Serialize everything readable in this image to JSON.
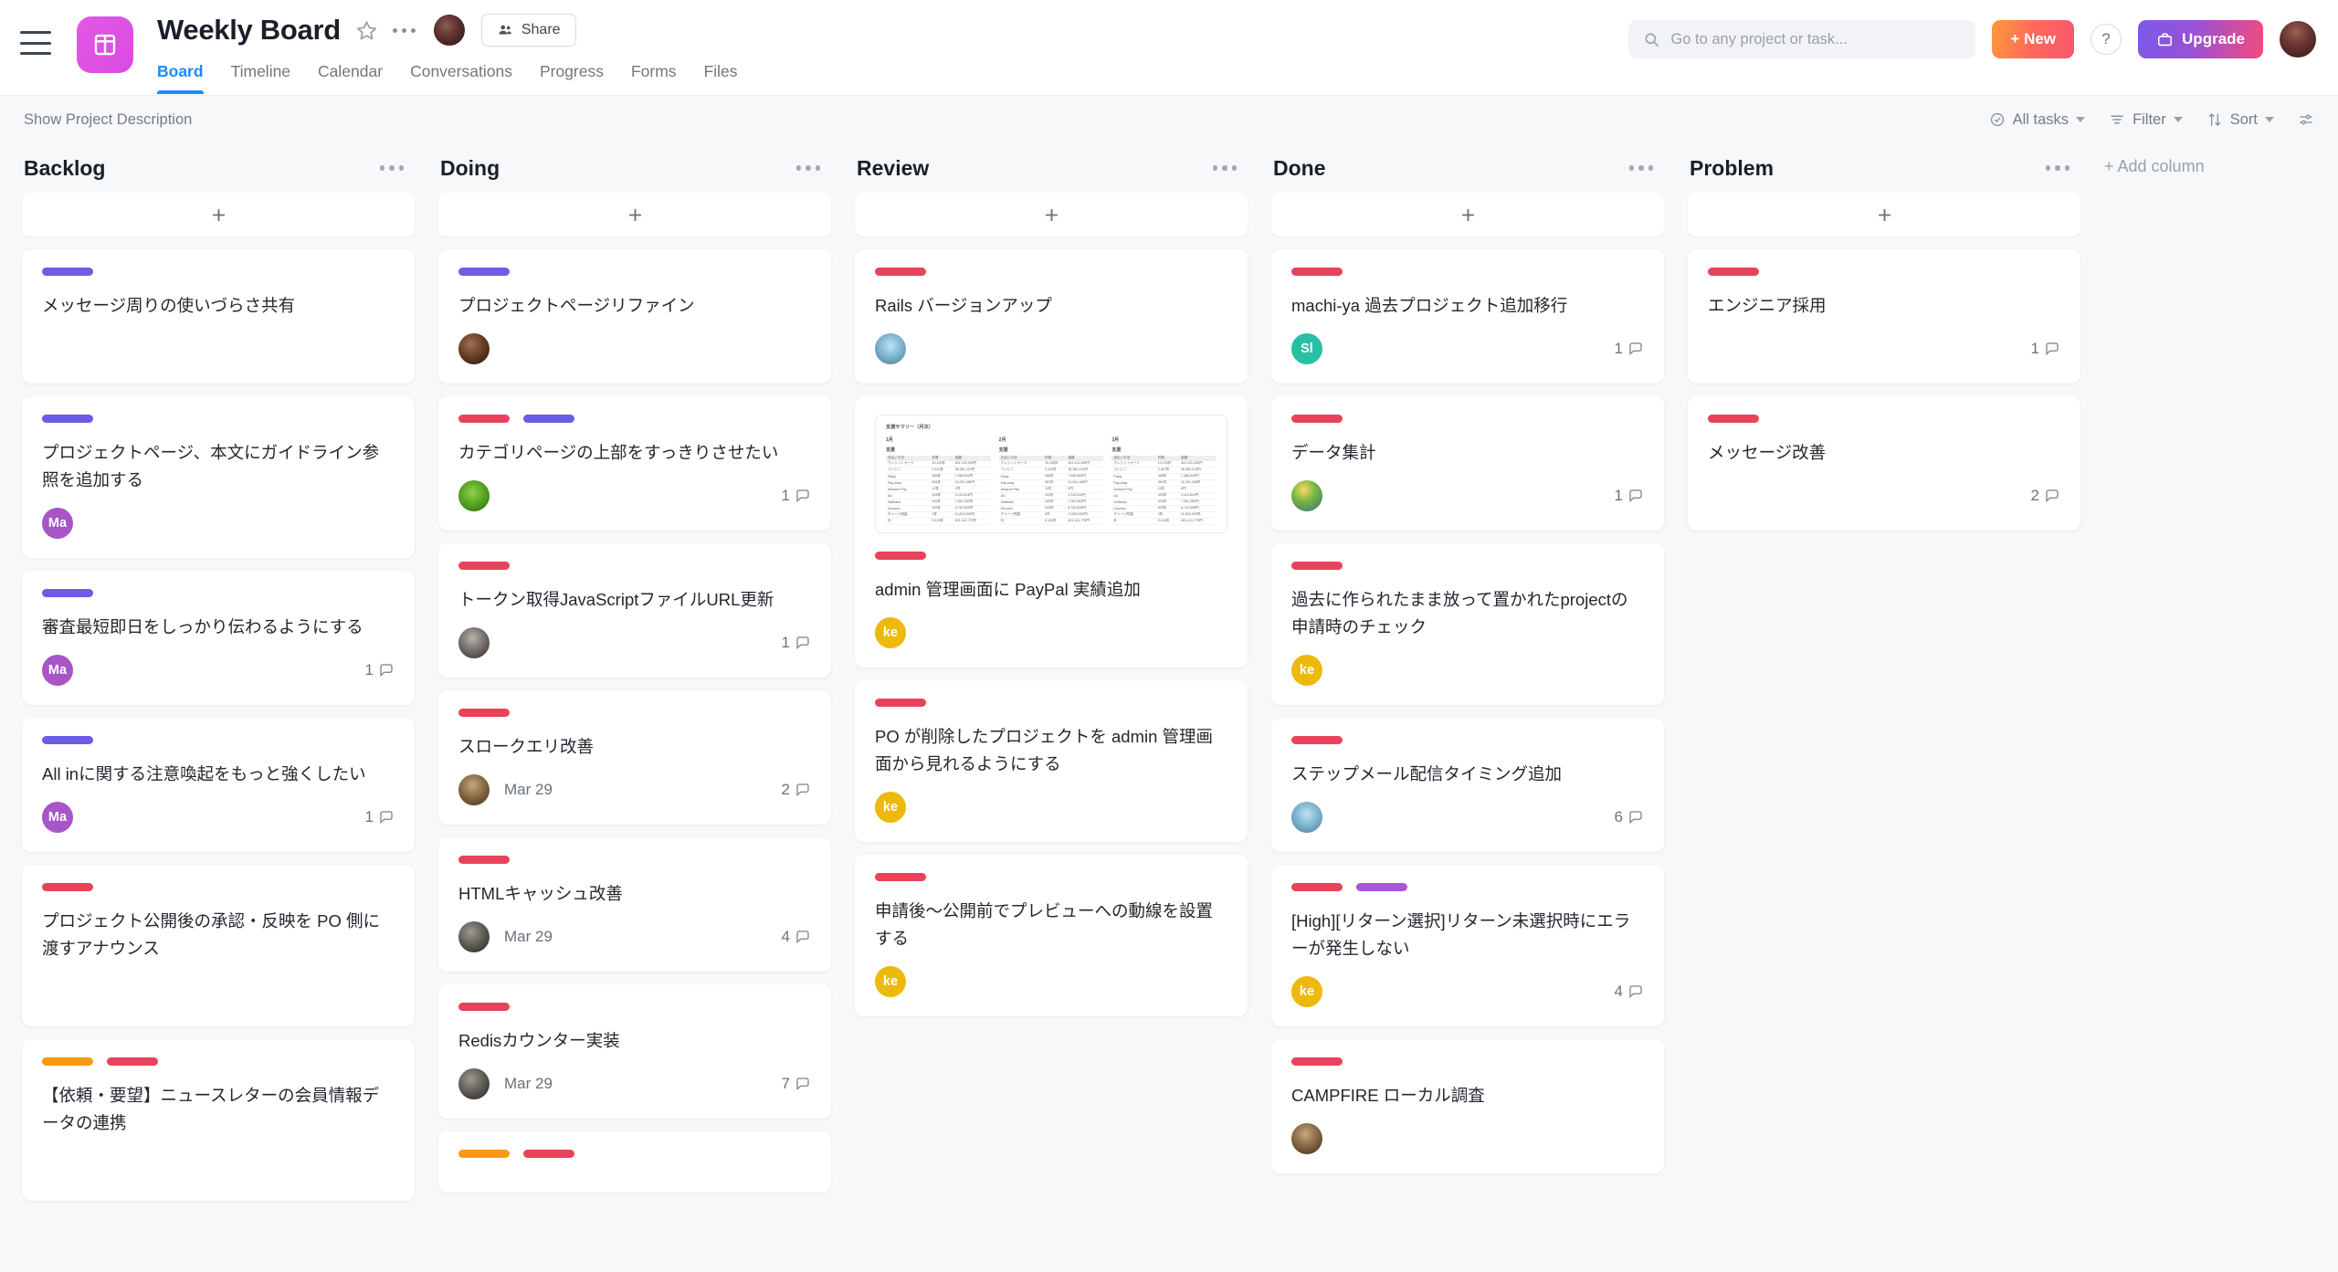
{
  "header": {
    "project_title": "Weekly Board",
    "share_label": "Share",
    "tabs": [
      {
        "label": "Board",
        "active": true
      },
      {
        "label": "Timeline",
        "active": false
      },
      {
        "label": "Calendar",
        "active": false
      },
      {
        "label": "Conversations",
        "active": false
      },
      {
        "label": "Progress",
        "active": false
      },
      {
        "label": "Forms",
        "active": false
      },
      {
        "label": "Files",
        "active": false
      }
    ],
    "search_placeholder": "Go to any project or task...",
    "new_label": "+ New",
    "help_label": "?",
    "upgrade_label": "Upgrade"
  },
  "subbar": {
    "show_description": "Show Project Description",
    "all_tasks": "All tasks",
    "filter": "Filter",
    "sort": "Sort"
  },
  "board": {
    "add_column_label": "+ Add column",
    "colors": {
      "label_red": "#E8435A",
      "label_purple": "#6C5CE7",
      "label_orange": "#F79A12",
      "label_violet": "#A855D8",
      "accent_blue": "#1A8CFF",
      "avatar_purple": "#A855C8",
      "avatar_yellow": "#EDB90C",
      "avatar_teal": "#28BFA3"
    },
    "columns": [
      {
        "title": "Backlog",
        "cards": [
          {
            "title": "メッセージ周りの使いづらさ共有",
            "labels": [
              "purple"
            ],
            "avatar": null,
            "date": null,
            "comments": null
          },
          {
            "title": "プロジェクトページ、本文にガイドライン参照を追加する",
            "labels": [
              "purple"
            ],
            "avatar": {
              "type": "initials",
              "text": "Ma",
              "color": "#A855C8"
            },
            "date": null,
            "comments": null
          },
          {
            "title": "審査最短即日をしっかり伝わるようにする",
            "labels": [
              "purple"
            ],
            "avatar": {
              "type": "initials",
              "text": "Ma",
              "color": "#A855C8"
            },
            "date": null,
            "comments": "1"
          },
          {
            "title": "All inに関する注意喚起をもっと強くしたい",
            "labels": [
              "purple"
            ],
            "avatar": {
              "type": "initials",
              "text": "Ma",
              "color": "#A855C8"
            },
            "date": null,
            "comments": "1"
          },
          {
            "title": "プロジェクト公開後の承認・反映を PO 側に渡すアナウンス",
            "labels": [
              "red"
            ],
            "avatar": null,
            "date": null,
            "comments": null
          },
          {
            "title": "【依頼・要望】ニュースレターの会員情報データの連携",
            "labels": [
              "orange",
              "red"
            ],
            "avatar": null,
            "date": null,
            "comments": null
          }
        ]
      },
      {
        "title": "Doing",
        "cards": [
          {
            "title": "プロジェクトページリファイン",
            "labels": [
              "purple"
            ],
            "avatar": {
              "type": "photo",
              "variant": "photo1"
            },
            "date": null,
            "comments": null
          },
          {
            "title": "カテゴリページの上部をすっきりさせたい",
            "labels": [
              "red",
              "purple"
            ],
            "avatar": {
              "type": "photo",
              "variant": "photo2"
            },
            "date": null,
            "comments": "1"
          },
          {
            "title": "トークン取得JavaScriptファイルURL更新",
            "labels": [
              "red"
            ],
            "avatar": {
              "type": "photo",
              "variant": "photo3"
            },
            "date": null,
            "comments": "1"
          },
          {
            "title": "スロークエリ改善",
            "labels": [
              "red"
            ],
            "avatar": {
              "type": "photo",
              "variant": "photo6"
            },
            "date": "Mar 29",
            "comments": "2"
          },
          {
            "title": "HTMLキャッシュ改善",
            "labels": [
              "red"
            ],
            "avatar": {
              "type": "photo",
              "variant": "photo7"
            },
            "date": "Mar 29",
            "comments": "4"
          },
          {
            "title": "Redisカウンター実装",
            "labels": [
              "red"
            ],
            "avatar": {
              "type": "photo",
              "variant": "photo7"
            },
            "date": "Mar 29",
            "comments": "7"
          },
          {
            "title": "",
            "labels": [
              "orange",
              "red"
            ],
            "avatar": null,
            "date": null,
            "comments": null,
            "partial": true
          }
        ]
      },
      {
        "title": "Review",
        "cards": [
          {
            "title": "Rails バージョンアップ",
            "labels": [
              "red"
            ],
            "avatar": {
              "type": "photo",
              "variant": "photo4"
            },
            "date": null,
            "comments": null
          },
          {
            "title": "admin 管理画面に PayPal 実績追加",
            "labels": [
              "red"
            ],
            "avatar": {
              "type": "initials",
              "text": "ke",
              "color": "#EDB90C"
            },
            "date": null,
            "comments": null,
            "thumbnail": {
              "title": "支援サマリー（月次）",
              "months": [
                "1月",
                "2月",
                "3月"
              ],
              "subheading": "支援",
              "columns": [
                "支払い方法",
                "件数",
                "金額"
              ],
              "rows": [
                [
                  "クレジットカード",
                  "10,120件",
                  "401,131,000円"
                ],
                [
                  "コンビニ",
                  "2,412件",
                  "36,381,213円"
                ],
                [
                  "Paidy",
                  "486件",
                  "7,486,843円"
                ],
                [
                  "Pay-easy",
                  "561件",
                  "11,241,166円"
                ],
                [
                  "Amazon Pay",
                  "12件",
                  "0円"
                ],
                [
                  "AU",
                  "434件",
                  "3,110,614円"
                ],
                [
                  "Softbank",
                  "442件",
                  "7,361,382円"
                ],
                [
                  "Docomo",
                  "533件",
                  "6,742,605円"
                ],
                [
                  "チャージ残高",
                  "2件",
                  "11,823,000円"
                ],
                [
                  "計",
                  "9,124件",
                  "401,141,779円"
                ]
              ]
            }
          },
          {
            "title": "PO が削除したプロジェクトを admin 管理画面から見れるようにする",
            "labels": [
              "red"
            ],
            "avatar": {
              "type": "initials",
              "text": "ke",
              "color": "#EDB90C"
            },
            "date": null,
            "comments": null
          },
          {
            "title": "申請後〜公開前でプレビューへの動線を設置する",
            "labels": [
              "red"
            ],
            "avatar": {
              "type": "initials",
              "text": "ke",
              "color": "#EDB90C"
            },
            "date": null,
            "comments": null
          }
        ]
      },
      {
        "title": "Done",
        "cards": [
          {
            "title": "machi-ya 過去プロジェクト追加移行",
            "labels": [
              "red"
            ],
            "avatar": {
              "type": "initials",
              "text": "Sl",
              "color": "#28BFA3"
            },
            "date": null,
            "comments": "1"
          },
          {
            "title": "データ集計",
            "labels": [
              "red"
            ],
            "avatar": {
              "type": "photo",
              "variant": "photo5"
            },
            "date": null,
            "comments": "1"
          },
          {
            "title": "過去に作られたまま放って置かれたprojectの申請時のチェック",
            "labels": [
              "red"
            ],
            "avatar": {
              "type": "initials",
              "text": "ke",
              "color": "#EDB90C"
            },
            "date": null,
            "comments": null
          },
          {
            "title": "ステップメール配信タイミング追加",
            "labels": [
              "red"
            ],
            "avatar": {
              "type": "photo",
              "variant": "photo4"
            },
            "date": null,
            "comments": "6"
          },
          {
            "title": "[High][リターン選択]リターン未選択時にエラーが発生しない",
            "labels": [
              "red",
              "violet"
            ],
            "avatar": {
              "type": "initials",
              "text": "ke",
              "color": "#EDB90C"
            },
            "date": null,
            "comments": "4"
          },
          {
            "title": "CAMPFIRE ローカル調査",
            "labels": [
              "red"
            ],
            "avatar": {
              "type": "photo",
              "variant": "photo6"
            },
            "date": null,
            "comments": null
          }
        ]
      },
      {
        "title": "Problem",
        "cards": [
          {
            "title": "エンジニア採用",
            "labels": [
              "red"
            ],
            "avatar": null,
            "date": null,
            "comments": "1"
          },
          {
            "title": "メッセージ改善",
            "labels": [
              "red"
            ],
            "avatar": null,
            "date": null,
            "comments": "2"
          }
        ]
      }
    ]
  }
}
